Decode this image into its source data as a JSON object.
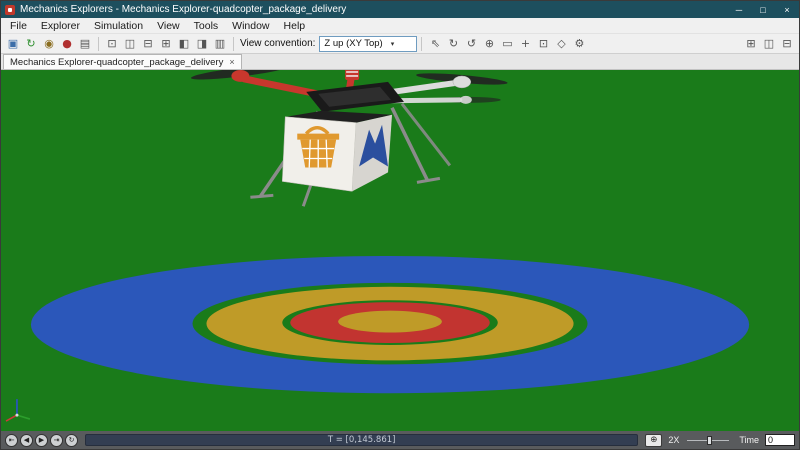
{
  "window": {
    "title": "Mechanics Explorers - Mechanics Explorer-quadcopter_package_delivery",
    "minimize_glyph": "─",
    "maximize_glyph": "□",
    "close_glyph": "×"
  },
  "menu": {
    "items": [
      "File",
      "Explorer",
      "Simulation",
      "View",
      "Tools",
      "Window",
      "Help"
    ]
  },
  "toolbar": {
    "view_convention_label": "View convention:",
    "view_convention_value": "Z up (XY Top)",
    "combo_caret": "▾",
    "file_icons": [
      {
        "name": "copy-view-icon",
        "glyph": "▣",
        "color": "#3c6ea8"
      },
      {
        "name": "replay-animation-icon",
        "glyph": "↻",
        "color": "#2f8f2f"
      },
      {
        "name": "snapshot-icon",
        "glyph": "◉",
        "color": "#8a6d1f"
      },
      {
        "name": "record-video-icon",
        "glyph": "●",
        "color": "#b03030"
      },
      {
        "name": "print-icon",
        "glyph": "▤",
        "color": "#555555"
      }
    ],
    "pane_icons": [
      {
        "name": "single-pane-icon",
        "glyph": "⊡"
      },
      {
        "name": "split-left-right-icon",
        "glyph": "◫"
      },
      {
        "name": "split-top-bottom-icon",
        "glyph": "⊟"
      },
      {
        "name": "four-pane-grid-icon",
        "glyph": "⊞"
      },
      {
        "name": "pane-layout-left-icon",
        "glyph": "◧"
      },
      {
        "name": "pane-layout-right-icon",
        "glyph": "◨"
      },
      {
        "name": "pane-layout-rows-icon",
        "glyph": "▥"
      }
    ],
    "view_icons": [
      {
        "name": "select-cursor-icon",
        "glyph": "⇖"
      },
      {
        "name": "rotate-view-icon",
        "glyph": "↻"
      },
      {
        "name": "roll-view-icon",
        "glyph": "↺"
      },
      {
        "name": "zoom-in-icon",
        "glyph": "⊕"
      },
      {
        "name": "zoom-region-icon",
        "glyph": "▭"
      },
      {
        "name": "pan-view-icon",
        "glyph": "+"
      },
      {
        "name": "fit-to-view-icon",
        "glyph": "⊡"
      },
      {
        "name": "perspective-icon",
        "glyph": "◇"
      },
      {
        "name": "video-preferences-icon",
        "glyph": "⚙"
      }
    ],
    "layout_icons": [
      {
        "name": "layout-four-grid-icon",
        "glyph": "⊞"
      },
      {
        "name": "layout-split-vertical-icon",
        "glyph": "◫"
      },
      {
        "name": "layout-split-horizontal-icon",
        "glyph": "⊟"
      }
    ]
  },
  "tab": {
    "label": "Mechanics Explorer-quadcopter_package_delivery",
    "close_glyph": "×"
  },
  "playback": {
    "buttons": [
      {
        "name": "go-to-start-icon",
        "glyph": "⇤"
      },
      {
        "name": "step-back-icon",
        "glyph": "◀"
      },
      {
        "name": "play-icon",
        "glyph": "▶"
      },
      {
        "name": "go-to-end-icon",
        "glyph": "⇥"
      },
      {
        "name": "loop-icon",
        "glyph": "↻"
      }
    ],
    "timeline_text": "T = [0,145.861]",
    "zoom_glyph": "⊕",
    "speed_label": "2X",
    "time_label": "Time",
    "time_value": "0"
  },
  "colors": {
    "titlebar": "#1d4f5e",
    "ground": "#1a7b1a",
    "pad_blue": "#2b57ba",
    "pad_gold": "#bf9b28",
    "pad_red": "#c23430",
    "drone_red": "#c8372d",
    "arm_white": "#dcdcdc",
    "body_dark": "#1a1a1a",
    "leg_gray": "#8b8b8b",
    "box_front": "#f1efea",
    "box_side": "#d7d5d0",
    "basket_orange": "#e0992f",
    "logo_blue": "#2b4f9e",
    "prop_dark": "#222222"
  }
}
